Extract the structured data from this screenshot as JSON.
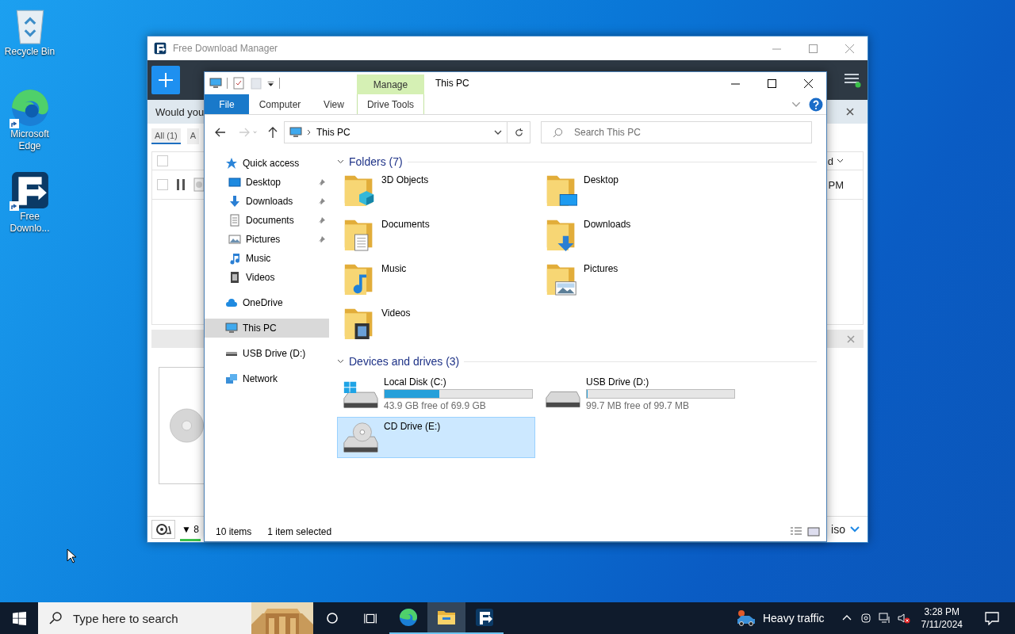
{
  "desktop_icons": [
    {
      "label": "Recycle Bin",
      "kind": "recycle",
      "shortcut": false
    },
    {
      "label": "Microsoft Edge",
      "kind": "edge",
      "shortcut": true
    },
    {
      "label": "Free Downlo...",
      "kind": "fdm",
      "shortcut": true
    }
  ],
  "fdm": {
    "title": "Free Download Manager",
    "banner": "Would you",
    "filters": [
      {
        "label": "All (1)",
        "selected": true
      },
      {
        "label": "A",
        "selected": false
      }
    ],
    "header_checked": false,
    "row_checked": false,
    "column_header": "d",
    "row_time": "PM",
    "speed": "▼ 8",
    "file_type": "iso"
  },
  "explorer": {
    "title": "This PC",
    "context_group": "Manage",
    "ribbon_tabs": [
      {
        "label": "File",
        "kind": "file"
      },
      {
        "label": "Computer",
        "kind": "tab"
      },
      {
        "label": "View",
        "kind": "tab"
      },
      {
        "label": "Drive Tools",
        "kind": "context"
      }
    ],
    "address": "This PC",
    "search_placeholder": "Search This PC",
    "nav": [
      {
        "label": "Quick access",
        "kind": "star",
        "selected": false,
        "children": [
          {
            "label": "Desktop",
            "kind": "desktop",
            "pinned": true,
            "selected": false
          },
          {
            "label": "Downloads",
            "kind": "downloads",
            "pinned": true,
            "selected": false
          },
          {
            "label": "Documents",
            "kind": "documents",
            "pinned": true,
            "selected": false
          },
          {
            "label": "Pictures",
            "kind": "pictures",
            "pinned": true,
            "selected": false
          },
          {
            "label": "Music",
            "kind": "music",
            "pinned": false,
            "selected": false
          },
          {
            "label": "Videos",
            "kind": "videos",
            "pinned": false,
            "selected": false
          }
        ]
      },
      {
        "label": "OneDrive",
        "kind": "cloud",
        "selected": false
      },
      {
        "label": "This PC",
        "kind": "pc",
        "selected": true
      },
      {
        "label": "USB Drive (D:)",
        "kind": "usb",
        "selected": false
      },
      {
        "label": "Network",
        "kind": "network",
        "selected": false
      }
    ],
    "folders_header": "Folders (7)",
    "folders": [
      {
        "name": "3D Objects",
        "kind": "objects"
      },
      {
        "name": "Desktop",
        "kind": "desktop"
      },
      {
        "name": "Documents",
        "kind": "documents"
      },
      {
        "name": "Downloads",
        "kind": "downloads"
      },
      {
        "name": "Music",
        "kind": "music"
      },
      {
        "name": "Pictures",
        "kind": "pictures"
      },
      {
        "name": "Videos",
        "kind": "videos"
      }
    ],
    "drives_header": "Devices and drives (3)",
    "drives": [
      {
        "name": "Local Disk (C:)",
        "kind": "system",
        "level": 0.37,
        "free": "43.9 GB free of 69.9 GB",
        "selected": false
      },
      {
        "name": "USB Drive (D:)",
        "kind": "removable",
        "level": 0,
        "free": "99.7 MB free of 99.7 MB",
        "selected": false
      },
      {
        "name": "CD Drive (E:)",
        "kind": "cd",
        "selected": true
      }
    ],
    "status_items": "10 items",
    "status_selected": "1 item selected"
  },
  "taskbar": {
    "search_placeholder": "Type here to search",
    "apps": [
      {
        "kind": "edge",
        "selected": false,
        "running": true
      },
      {
        "kind": "explorer",
        "selected": true,
        "running": true
      },
      {
        "kind": "fdm",
        "selected": false,
        "running": true
      }
    ],
    "weather": "Heavy traffic",
    "time": "3:28 PM",
    "date": "7/11/2024"
  }
}
